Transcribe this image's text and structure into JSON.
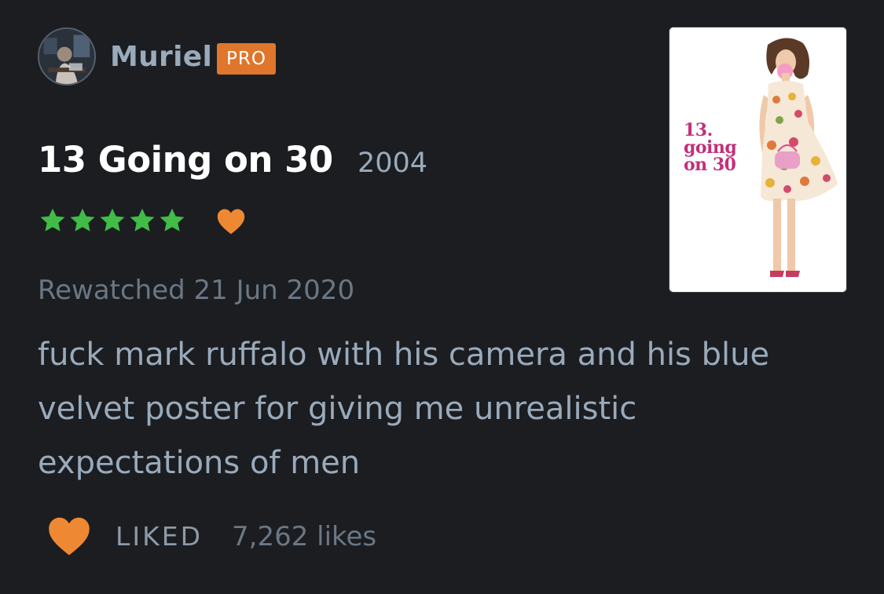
{
  "user": {
    "name": "Muriel",
    "badge": "PRO"
  },
  "film": {
    "title": "13 Going on 30",
    "year": "2004",
    "poster_title": "13.\ngoing\non 30"
  },
  "rating": {
    "stars": 5,
    "max_stars": 5,
    "liked": true,
    "star_color": "#40bc47",
    "heart_color": "#ef8833"
  },
  "entry": {
    "date_text": "Rewatched 21 Jun 2020"
  },
  "review": {
    "text": "fuck mark ruffalo with his camera and his blue velvet poster for giving me unrealistic expectations of men"
  },
  "likes": {
    "label": "LIKED",
    "count_text": "7,262 likes"
  },
  "colors": {
    "background": "#1b1d21",
    "accent": "#e0762b",
    "text_primary": "#ffffff",
    "text_secondary": "#99aabb"
  }
}
